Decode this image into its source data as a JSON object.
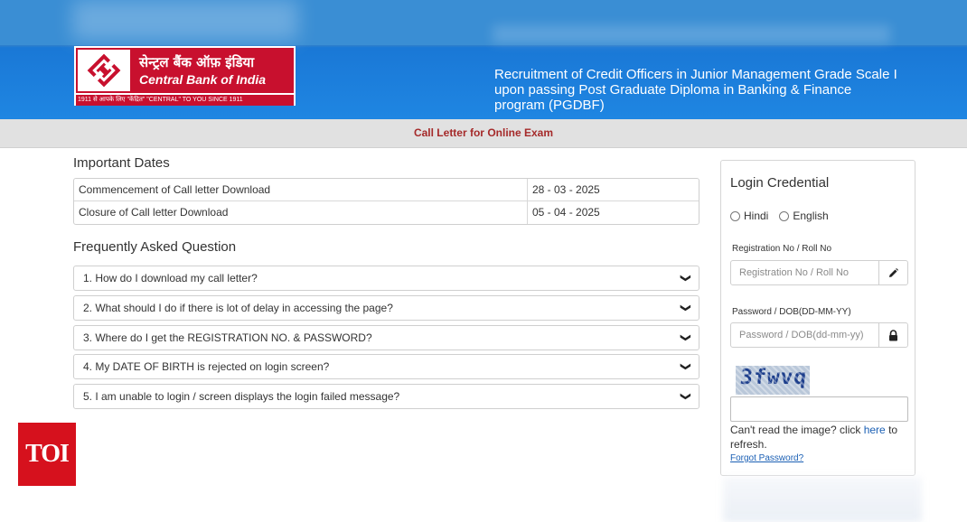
{
  "header": {
    "logo_hindi": "सेन्ट्रल बैंक ऑफ़ इंडिया",
    "logo_english": "Central Bank of India",
    "logo_tagline": "1911 से आपके लिए \"केंद्रित\"  \"CENTRAL\" TO YOU SINCE 1911",
    "title": "Recruitment of Credit Officers in Junior Management Grade Scale I upon passing Post Graduate Diploma in Banking & Finance program (PGDBF)"
  },
  "subbar": {
    "label": "Call Letter for Online Exam"
  },
  "important_dates": {
    "heading": "Important Dates",
    "rows": [
      {
        "label": "Commencement of Call letter Download",
        "value": "28 - 03 - 2025"
      },
      {
        "label": "Closure of Call letter Download",
        "value": "05 - 04 - 2025"
      }
    ]
  },
  "faq": {
    "heading": "Frequently Asked Question",
    "items": [
      "1. How do I download my call letter?",
      "2. What should I do if there is lot of delay in accessing the page?",
      "3. Where do I get the REGISTRATION NO. & PASSWORD?",
      "4. My DATE OF BIRTH is rejected on login screen?",
      "5. I am unable to login / screen displays the login failed message?"
    ]
  },
  "login": {
    "title": "Login Credential",
    "lang_hindi": "Hindi",
    "lang_english": "English",
    "reg_label": "Registration No / Roll No",
    "reg_placeholder": "Registration No / Roll No",
    "pwd_label": "Password / DOB(DD-MM-YY)",
    "pwd_placeholder": "Password / DOB(dd-mm-yy)",
    "captcha_text": "3fwvq",
    "cant_read_prefix": "Can't read the image? click ",
    "cant_read_link": "here",
    "cant_read_suffix": " to refresh.",
    "forgot": "Forgot Password?"
  },
  "watermark": {
    "label": "TOI"
  },
  "icons": {
    "reg_addon": "pencil-icon",
    "pwd_addon": "lock-icon",
    "faq_toggle": "chevron-down-icon"
  },
  "colors": {
    "banner": "#1f86e2",
    "logo_red": "#c8102e",
    "subbar_text": "#a52a2a",
    "link": "#1a5fb4",
    "toi_red": "#d6111d"
  }
}
